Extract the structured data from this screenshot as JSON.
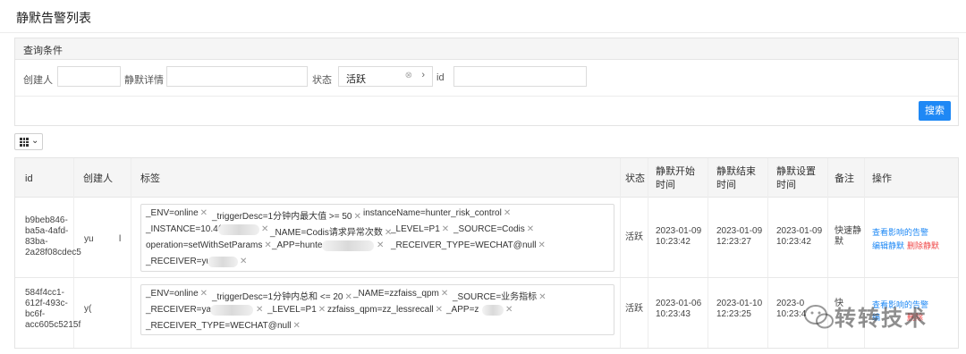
{
  "page": {
    "title": "静默告警列表"
  },
  "query": {
    "header": "查询条件",
    "creator_label": "创建人",
    "detail_label": "静默详情",
    "status_label": "状态",
    "status_value": "活跃",
    "id_label": "id",
    "search_label": "搜索"
  },
  "table": {
    "columns": [
      "id",
      "创建人",
      "标签",
      "状态",
      "静默开始时间",
      "静默结束时间",
      "静默设置时间",
      "备注",
      "操作"
    ],
    "rows": [
      {
        "id_lines": [
          "b9beb846-",
          "ba5a-4afd-",
          "83ba-",
          "2a28f08cdec5"
        ],
        "creator": "yu",
        "creator_tail": "l",
        "tags": [
          "_ENV=online",
          "_triggerDesc=1分钟内最大值 >= 50",
          "instanceName=hunter_risk_control",
          "_INSTANCE=10.4(",
          "_NAME=Codis请求异常次数",
          "_LEVEL=P1",
          "_SOURCE=Codis",
          "operation=setWithSetParams",
          "_APP=hunte",
          "_RECEIVER_TYPE=WECHAT@null",
          "_RECEIVER=yu"
        ],
        "status": "活跃",
        "start": [
          "2023-01-09",
          "10:23:42"
        ],
        "end": [
          "2023-01-09",
          "12:23:27"
        ],
        "set": [
          "2023-01-09",
          "10:23:42"
        ],
        "note": [
          "快速静",
          "默"
        ],
        "actions": {
          "view": "查看影响的告警",
          "edit": "编辑静默",
          "delete": "删除静默"
        }
      },
      {
        "id_lines": [
          "584f4cc1-",
          "612f-493c-",
          "bc6f-",
          "acc605c5215f"
        ],
        "creator": "y(",
        "tags": [
          "_ENV=online",
          "_triggerDesc=1分钟内总和 <= 20",
          "_NAME=zzfaiss_qpm",
          "_SOURCE=业务指标",
          "_RECEIVER=yan",
          "_LEVEL=P1",
          "zzfaiss_qpm=zz_lessrecall",
          "_APP=z",
          "_RECEIVER_TYPE=WECHAT@null"
        ],
        "status": "活跃",
        "start": [
          "2023-01-06",
          "10:23:43"
        ],
        "end": [
          "2023-01-10",
          "12:23:25"
        ],
        "set": [
          "2023-0",
          "10:23:4"
        ],
        "note": [
          "快"
        ],
        "actions": {
          "view": "查看影响的告警",
          "edit": "编",
          "delete": "删除"
        }
      }
    ]
  },
  "watermark": {
    "text": "转转技术"
  }
}
